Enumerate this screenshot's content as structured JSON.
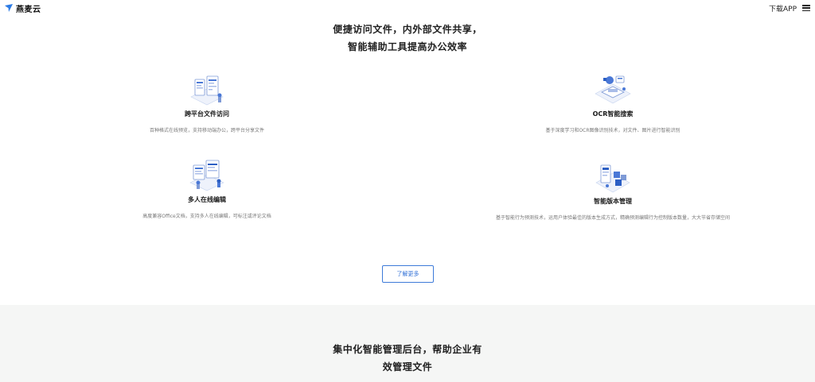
{
  "header": {
    "brand_name": "燕麦云",
    "download_label": "下载APP",
    "icons": {
      "logo": "swallow-logo-icon",
      "menu": "hamburger-menu-icon"
    },
    "colors": {
      "logo": "#2c7be5"
    }
  },
  "hero": {
    "line1": "便捷访问文件，内外部文件共享，",
    "line2": "智能辅助工具提高办公效率"
  },
  "features": [
    {
      "title": "跨平台文件访问",
      "desc": "百种格式在线预览，支持移动端办公，跨平台分享文件",
      "icon": "cross-platform-illustration-icon"
    },
    {
      "title": "OCR智能搜索",
      "desc": "基于深度学习和OCR图像识别技术，对文件、图片进行智能识别",
      "icon": "ocr-search-illustration-icon"
    },
    {
      "title": "多人在线编辑",
      "desc": "高度兼容Office文档，支持多人在线编辑，可标注或评论文档",
      "icon": "online-edit-illustration-icon"
    },
    {
      "title": "智能版本管理",
      "desc": "基于智能行为预测技术，运用户体验最佳的版本生成方式，精确预测编辑行为控制版本数量，大大节省存储空间",
      "icon": "version-management-illustration-icon"
    }
  ],
  "more_button": {
    "label": "了解更多",
    "color": "#3d7bd9"
  },
  "section2": {
    "line1": "集中化智能管理后台，帮助企业有",
    "line2": "效管理文件",
    "background": "#f5f6f5"
  }
}
